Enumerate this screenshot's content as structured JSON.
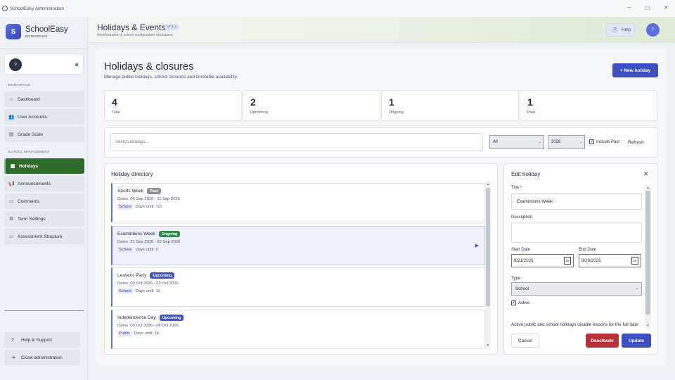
{
  "window": {
    "title": "SchoolEasy Administration",
    "controls": [
      "─",
      "▢",
      "✕"
    ]
  },
  "brand": {
    "logo_letter": "S",
    "name": "SchoolEasy",
    "edition": "ENTERPRISE"
  },
  "user": {
    "avatar": "?"
  },
  "sidebar": {
    "workspace_label": "WORKSPACE",
    "workspace_items": [
      {
        "label": "Dashboard",
        "icon": "home-icon"
      },
      {
        "label": "User Accounts",
        "icon": "users-icon"
      },
      {
        "label": "Grade Scale",
        "icon": "grid-icon"
      }
    ],
    "management_label": "SCHOOL MANAGEMENT",
    "management_items": [
      {
        "label": "Holidays",
        "icon": "calendar-icon",
        "active": true
      },
      {
        "label": "Announcements",
        "icon": "megaphone-icon"
      },
      {
        "label": "Comments",
        "icon": "comment-icon"
      },
      {
        "label": "Term Settings",
        "icon": "gear-icon"
      },
      {
        "label": "Assessment Structure",
        "icon": "structure-icon"
      }
    ],
    "footer": {
      "help": "Help & Support",
      "close": "Close administration"
    }
  },
  "header": {
    "title": "Holidays & Events",
    "version": "v7.1.2",
    "subtitle": "Administration & school configuration workspace",
    "help_label": "Help",
    "avatar": "?"
  },
  "page": {
    "title": "Holidays & closures",
    "subtitle": "Manage public holidays, school closures and timetable availability.",
    "new_button": "+ New holiday"
  },
  "stats": [
    {
      "value": "4",
      "label": "Total"
    },
    {
      "value": "2",
      "label": "Upcoming"
    },
    {
      "value": "1",
      "label": "Ongoing"
    },
    {
      "value": "1",
      "label": "Past"
    }
  ],
  "filters": {
    "search_placeholder": "Search holidays...",
    "category_value": "All",
    "year_value": "2026",
    "include_past_label": "Include Past",
    "include_past_checked": true,
    "refresh_label": "Refresh"
  },
  "directory": {
    "title": "Holiday directory",
    "dates_prefix": "Dates",
    "days_prefix": "Days until:",
    "items": [
      {
        "name": "Sports Week",
        "status": "Past",
        "status_kind": "past",
        "dates": "06 Sep 2026 - 11 Sep 2026",
        "category": "School",
        "days_until": "-15",
        "selected": false
      },
      {
        "name": "Examintions Week",
        "status": "Ongoing",
        "status_kind": "ongoing",
        "dates": "21 Sep 2026 - 26 Sep 2026",
        "category": "School",
        "days_until": "0",
        "selected": true
      },
      {
        "name": "Leavers' Party",
        "status": "Upcoming",
        "status_kind": "upcoming",
        "dates": "03 Oct 2026 - 03 Oct 2026",
        "category": "School",
        "days_until": "12",
        "selected": false
      },
      {
        "name": "Independence Day",
        "status": "Upcoming",
        "status_kind": "upcoming",
        "dates": "09 Oct 2026 - 08 Oct 2026",
        "category": "Public",
        "days_until": "18",
        "selected": false
      }
    ]
  },
  "edit": {
    "title": "Edit holiday",
    "title_label": "Title *",
    "title_value": "Examintions Week",
    "description_label": "Description",
    "description_value": "",
    "start_label": "Start Date",
    "start_value": "9/21/2026",
    "end_label": "End Date",
    "end_value": "9/26/2026",
    "calendar_glyph": "15",
    "type_label": "Type",
    "type_value": "School",
    "active_label": "Active",
    "active_checked": true,
    "note": "Active public and school holidays disable lessons for the full date",
    "cancel": "Cancel",
    "deactivate": "Deactivate",
    "update": "Update"
  },
  "colors": {
    "accent": "#3b4fc0",
    "active_nav": "#2f6b2a",
    "ongoing": "#2f8a4f",
    "past": "#8a8f96",
    "danger": "#b8323a"
  }
}
